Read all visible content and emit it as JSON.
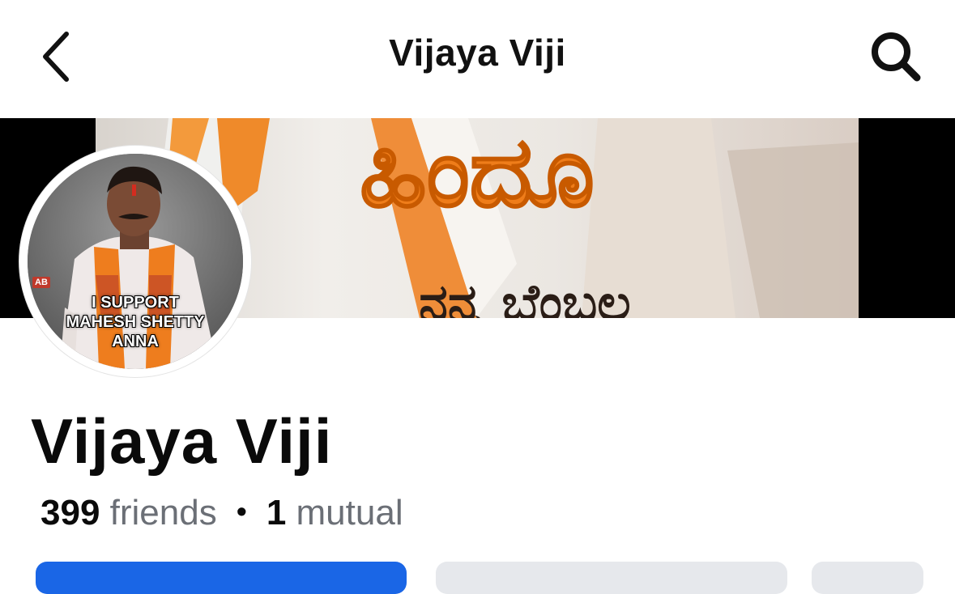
{
  "header": {
    "title": "Vijaya Viji",
    "back_icon": "chevron-left-icon",
    "search_icon": "search-icon"
  },
  "cover": {
    "headline_text": "ಹಿಂದೂ",
    "subline_text": "ನನ್ನ ಬೆಂಬಲ",
    "accent_color": "#ef7d1a"
  },
  "avatar": {
    "caption_lines": [
      "I SUPPORT",
      "MAHESH SHETTY",
      "ANNA"
    ],
    "badge": "AB"
  },
  "profile": {
    "name": "Vijaya Viji",
    "friends_count": "399",
    "friends_label": "friends",
    "separator": "•",
    "mutual_count": "1",
    "mutual_label": "mutual"
  },
  "colors": {
    "primary_button": "#1a66e6",
    "secondary_button": "#e6e8ec",
    "muted_text": "#6b6f76"
  }
}
